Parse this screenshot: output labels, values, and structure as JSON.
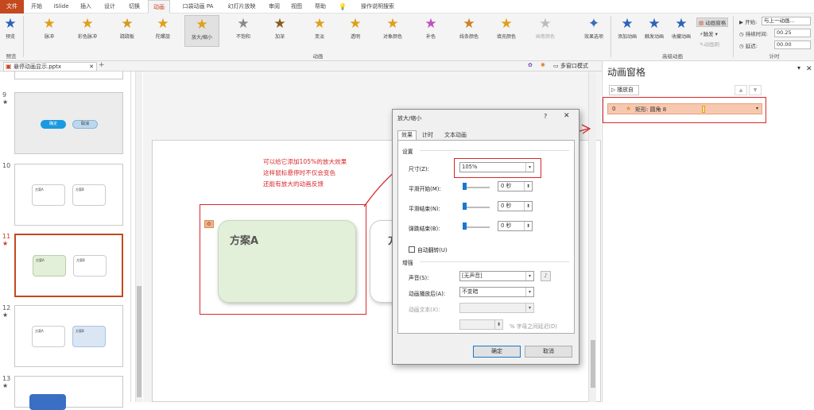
{
  "tabs": [
    "文件",
    "开始",
    "iSlide",
    "插入",
    "设计",
    "切换",
    "动画",
    "口袋动画 PA",
    "幻灯片放映",
    "审阅",
    "视图",
    "帮助",
    "操作说明搜索"
  ],
  "ribbon": {
    "preview": "预览",
    "preview_group": "预览",
    "effects": [
      "脉冲",
      "彩色脉冲",
      "跷跷板",
      "陀螺旋",
      "放大/缩小",
      "不饱和",
      "加深",
      "变淡",
      "透明",
      "对象颜色",
      "补色",
      "线条颜色",
      "填充颜色",
      "画笔颜色"
    ],
    "effect_options": "效果选项",
    "animation_group": "动画",
    "add_anim": "添加动画",
    "trigger_anim": "触发动画",
    "favorite_anim": "收藏动画",
    "anim_pane": "动画窗格",
    "trigger": "触发",
    "anim_painter": "动画刷",
    "advanced_group": "高级动画",
    "start_label": "开始:",
    "start_value": "与上一动画...",
    "duration_label": "持续时间:",
    "duration_value": "00.25",
    "delay_label": "延迟:",
    "delay_value": "00.00",
    "timing_group": "计时"
  },
  "document": {
    "filename": "悬停动画显示.pptx",
    "view_mode": "多窗口模式"
  },
  "slide_numbers": [
    "9",
    "10",
    "11",
    "12",
    "13"
  ],
  "thumb": {
    "confirm": "确定",
    "cancel": "取消",
    "plan_a": "方案A",
    "plan_b": "方案B"
  },
  "slide": {
    "tag": "0",
    "card_a": "方案A",
    "card_b": "方"
  },
  "annotation": [
    "可以给它添加105%的放大效果",
    "这样鼠标悬停时不仅会变色",
    "还能有放大的动画反馈"
  ],
  "anim_pane": {
    "title": "动画窗格",
    "play_from": "播放自",
    "item_index": "0",
    "item_label": "矩形: 圆角 8"
  },
  "dialog": {
    "title": "放大/缩小",
    "tabs": [
      "效果",
      "计时",
      "文本动画"
    ],
    "settings_header": "设置",
    "size_label": "尺寸(Z):",
    "size_value": "105%",
    "smooth_start_label": "平滑开始(M):",
    "smooth_start_value": "0 秒",
    "smooth_end_label": "平滑结束(N):",
    "smooth_end_value": "0 秒",
    "bounce_end_label": "弹跳结束(B):",
    "bounce_end_value": "0 秒",
    "autoreverse_label": "自动翻转(U)",
    "enhance_header": "增强",
    "sound_label": "声音(S):",
    "sound_value": "[无声音]",
    "after_anim_label": "动画播放后(A):",
    "after_anim_value": "不变暗",
    "anim_text_label": "动画文本(X):",
    "delay_pct_label": "% 字母之间延迟(D)",
    "ok": "确定",
    "cancel": "取消"
  },
  "colors": {
    "accent": "#c43e1c",
    "annotation_red": "#d9282b",
    "card_green": "#e2efd9",
    "selected_blue": "#1879d2"
  }
}
